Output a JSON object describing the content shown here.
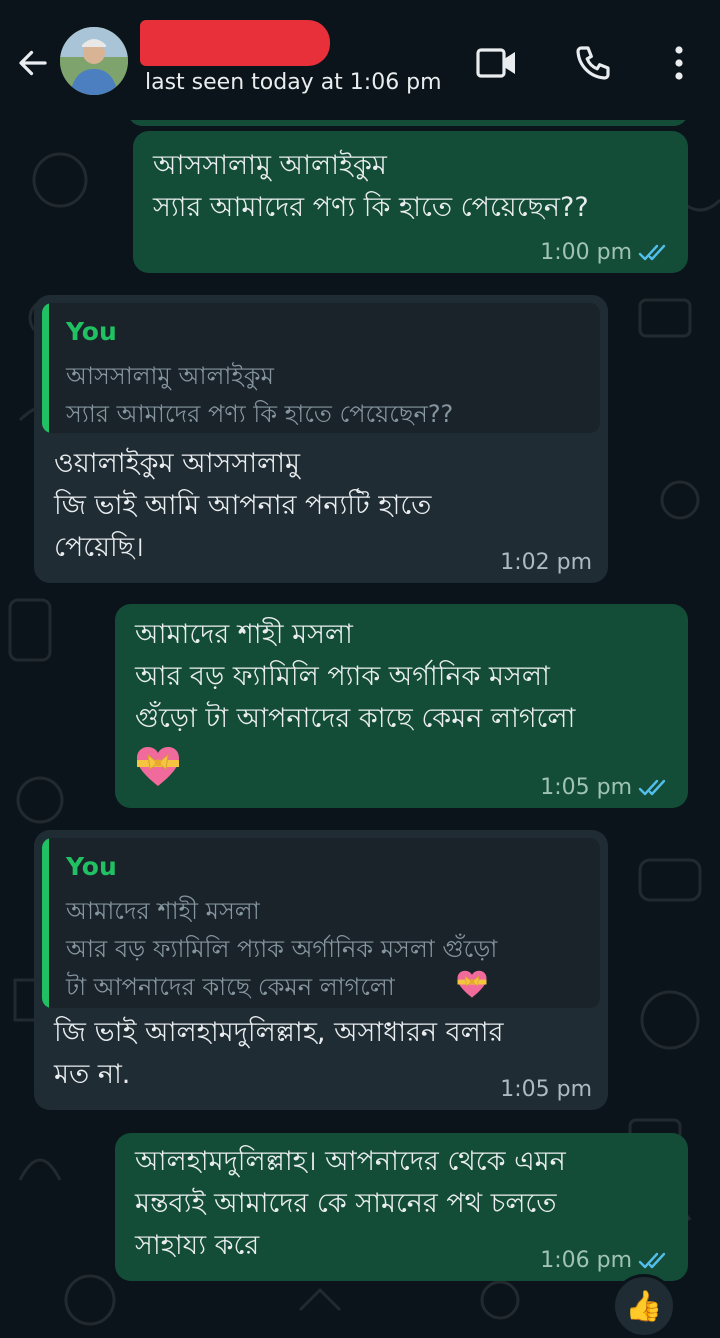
{
  "header": {
    "last_seen": "last seen today at 1:06 pm",
    "icons": [
      "back-arrow-icon",
      "video-call-icon",
      "voice-call-icon",
      "more-options-icon"
    ]
  },
  "messages": [
    {
      "direction": "outgoing",
      "text": "আসসালামু আলাইকুম\nস্যার আমাদের পণ্য কি হাতে পেয়েছেন??",
      "time": "1:00 pm",
      "status": "read"
    },
    {
      "direction": "incoming",
      "quote": {
        "author": "You",
        "text": "আসসালামু আলাইকুম\nস্যার আমাদের পণ্য কি হাতে পেয়েছেন??"
      },
      "text": "ওয়ালাইকুম আসসালামু\nজি ভাই আমি আপনার পন্যটি হাতে\nপেয়েছি।",
      "time": "1:02 pm"
    },
    {
      "direction": "outgoing",
      "text": "আমাদের শাহী মসলা\nআর বড় ফ্যামিলি প্যাক অর্গানিক মসলা\nগুঁড়ো টা আপনাদের কাছে কেমন লাগলো",
      "emoji": "heart-with-ribbon",
      "time": "1:05 pm",
      "status": "read"
    },
    {
      "direction": "incoming",
      "quote": {
        "author": "You",
        "text": "আমাদের শাহী মসলা\nআর বড় ফ্যামিলি প্যাক অর্গানিক মসলা গুঁড়ো\nটা আপনাদের কাছে কেমন লাগলো"
      },
      "text": "জি ভাই আলহামদুলিল্লাহ, অসাধারন বলার\nমত না.",
      "time": "1:05 pm"
    },
    {
      "direction": "outgoing",
      "text": "আলহামদুলিল্লাহ। আপনাদের থেকে এমন\nমন্তব্যই আমাদের কে সামনের পথ চলতে\nসাহায্য করে",
      "time": "1:06 pm",
      "status": "read",
      "reaction": "👍"
    }
  ],
  "colors": {
    "background": "#0b141a",
    "outgoing_bubble": "#144d37",
    "incoming_bubble": "#202c33",
    "quote_accent": "#21c063",
    "read_tick": "#53bdeb"
  }
}
